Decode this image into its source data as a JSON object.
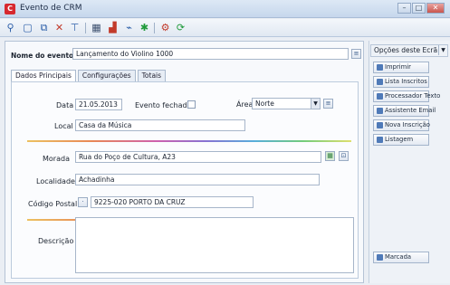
{
  "window": {
    "title": "Evento de CRM",
    "app_icon": "crm-app-icon"
  },
  "toolbar": {
    "icons": [
      "search-icon",
      "new-record-icon",
      "copy-icon",
      "delete-icon",
      "filter-icon",
      "grid-icon",
      "chart-icon",
      "link-icon",
      "settings-icon",
      "refresh-icon"
    ]
  },
  "form": {
    "event_name_label": "Nome do evento",
    "event_name_value": "Lançamento do Violino 1000",
    "tabs": [
      "Dados Principais",
      "Configurações",
      "Totais"
    ],
    "date_label": "Data",
    "date_value": "21.05.2013",
    "closed_label": "Evento fechado",
    "closed_checked": false,
    "area_label": "Área",
    "area_value": "Norte",
    "local_label": "Local",
    "local_value": "Casa da Música",
    "address_label": "Morada",
    "address_value": "Rua do Poço de Cultura, A23",
    "locality_label": "Localidade",
    "locality_value": "Achadinha",
    "postal_label": "Código Postal",
    "postal_value": "9225-020 PORTO DA CRUZ",
    "description_label": "Descrição",
    "description_value": ""
  },
  "sidebar": {
    "options_label": "Opções deste Ecrã",
    "buttons": [
      "Imprimir",
      "Lista Inscritos",
      "Processador Texto",
      "Assistente Email",
      "Nova Inscrição",
      "Listagem"
    ],
    "bottom_button": "Marcada"
  },
  "colors": {
    "title_bar": "#c6d7ec",
    "accent": "#d7282f"
  }
}
